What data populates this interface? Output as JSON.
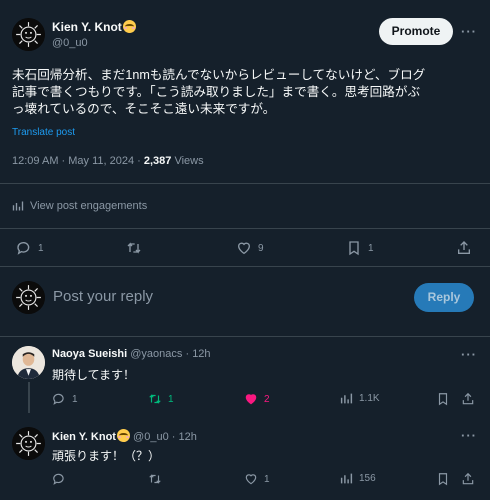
{
  "tweet": {
    "author_name": "Kien Y. Knot",
    "author_handle": "@0_u0",
    "promote_label": "Promote",
    "more_glyph": "···",
    "text_line1": "未石回帰分析、まだ1nmも読んでないからレビューしてないけど、ブログ",
    "text_line2": "記事で書くつもりです。「こう読み取りました」まで書く。思考回路がぶ",
    "text_line3": "っ壊れているので、そこそこ遠い未来ですが。",
    "translate_label": "Translate post",
    "timestamp": "12:09 AM · May 11, 2024 · ",
    "views_count": "2,387",
    "views_label": "Views",
    "engagements_label": "View post engagements",
    "reply_count": "1",
    "retweet_count": "",
    "like_count": "9",
    "bookmark_count": "1"
  },
  "composer": {
    "placeholder": "Post your reply",
    "reply_label": "Reply"
  },
  "replies": [
    {
      "author_name": "Naoya Sueishi",
      "author_handle": "@yaonacs",
      "time": "· 12h",
      "text": "期待してます！",
      "reply_count": "1",
      "retweet_count": "1",
      "like_count": "2",
      "views_count": "1.1K"
    },
    {
      "author_name": "Kien Y. Knot",
      "author_handle": "@0_u0",
      "time": "· 12h",
      "text": "頑張ります！（？）",
      "reply_count": "",
      "retweet_count": "",
      "like_count": "1",
      "views_count": "156"
    }
  ],
  "colors": {
    "background": "#15202b",
    "accent": "#1d9bf0",
    "retweet_green": "#00ba7c",
    "like_pink": "#f91880",
    "muted": "#8b98a5"
  },
  "icons": [
    "reply-icon",
    "retweet-icon",
    "like-icon",
    "bookmark-icon",
    "share-icon",
    "views-icon",
    "engagements-icon",
    "more-icon"
  ]
}
